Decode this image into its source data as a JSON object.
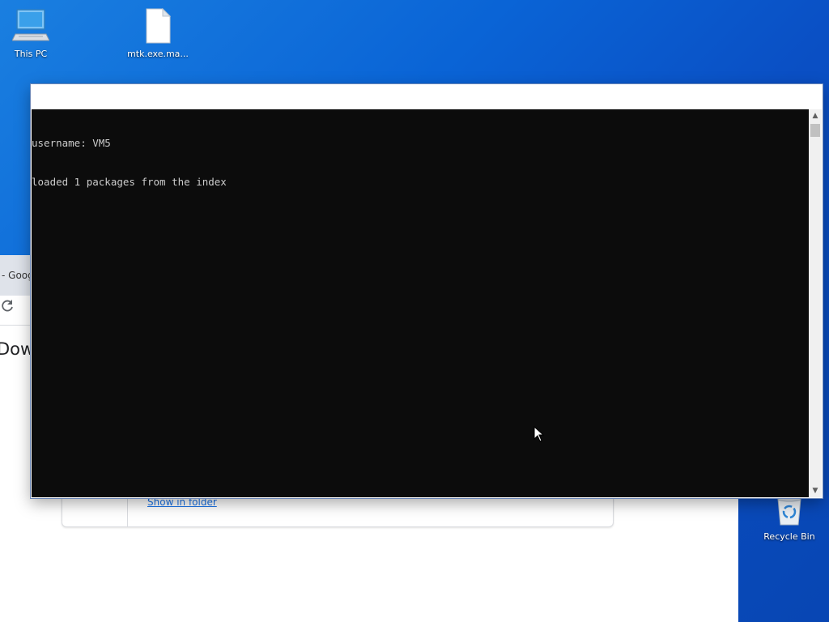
{
  "desktop": {
    "icons": [
      {
        "label": "This PC",
        "icon": "computer-icon"
      },
      {
        "label": "mtk.exe.ma...",
        "icon": "file-icon"
      },
      {
        "label": "Recycle Bin",
        "icon": "recycle-bin-icon"
      }
    ]
  },
  "browser": {
    "title_fragment": "- Goog",
    "heading_fragment": "Dow",
    "download_item": {
      "show_in_folder_label": "Show in folder"
    }
  },
  "console": {
    "lines": [
      "username: VM5",
      "loaded 1 packages from the index"
    ]
  },
  "colors": {
    "console_bg": "#0c0c0c",
    "console_text": "#cccccc",
    "desktop_blue": "#0a64d6",
    "link_blue": "#1a73e8"
  }
}
